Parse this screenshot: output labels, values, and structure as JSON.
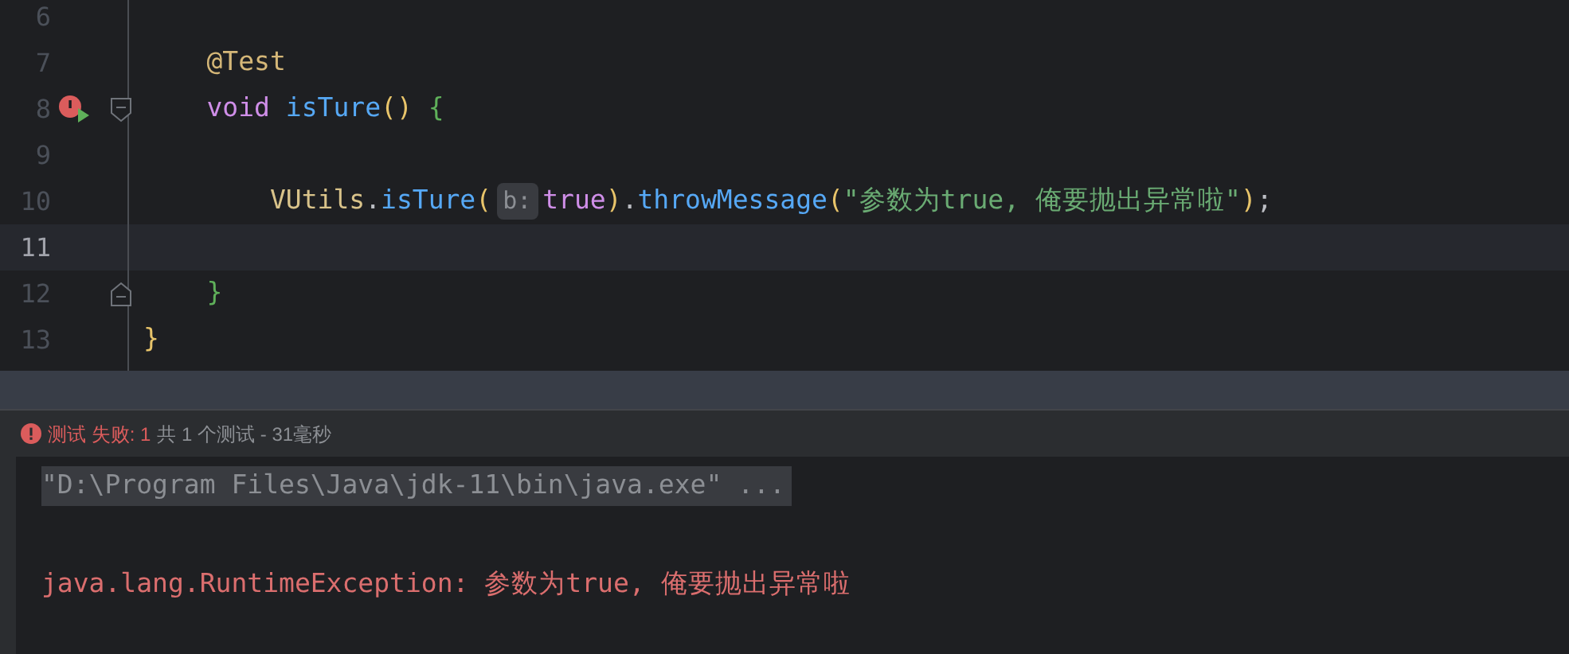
{
  "editor": {
    "lines": [
      {
        "number": "6",
        "current": false
      },
      {
        "number": "7",
        "current": false,
        "tokens": [
          {
            "kind": "annotation",
            "text": "    @Test"
          }
        ]
      },
      {
        "number": "8",
        "current": false,
        "gutter_icons": [
          {
            "kind": "failed_test_run"
          },
          {
            "kind": "fold_start"
          }
        ],
        "tokens": [
          {
            "kind": "keyword",
            "text": "    void"
          },
          {
            "kind": "method",
            "text": " isTure"
          },
          {
            "kind": "paren",
            "text": "()"
          },
          {
            "kind": "brace",
            "text": " {"
          }
        ]
      },
      {
        "number": "9",
        "current": false
      },
      {
        "number": "10",
        "current": false,
        "tokens": [
          {
            "kind": "class",
            "text": "        VUtils"
          },
          {
            "kind": "plain",
            "text": "."
          },
          {
            "kind": "method",
            "text": "isTure"
          },
          {
            "kind": "paren",
            "text": "("
          },
          {
            "kind": "hint",
            "text": "b:"
          },
          {
            "kind": "keyword",
            "text": "true"
          },
          {
            "kind": "paren",
            "text": ")"
          },
          {
            "kind": "plain",
            "text": "."
          },
          {
            "kind": "method",
            "text": "throwMessage"
          },
          {
            "kind": "paren",
            "text": "("
          },
          {
            "kind": "string",
            "text": "\"参数为true, 俺要抛出异常啦\""
          },
          {
            "kind": "paren",
            "text": ")"
          },
          {
            "kind": "plain",
            "text": ";"
          }
        ]
      },
      {
        "number": "11",
        "current": true
      },
      {
        "number": "12",
        "current": false,
        "gutter_icons": [
          {
            "kind": "fold_end"
          }
        ],
        "tokens": [
          {
            "kind": "brace",
            "text": "    }"
          }
        ]
      },
      {
        "number": "13",
        "current": false,
        "tokens": [
          {
            "kind": "paren",
            "text": "}"
          }
        ]
      }
    ]
  },
  "test_status": {
    "failed": "测试 失败: 1",
    "summary": "共 1 个测试 - 31毫秒"
  },
  "console": {
    "lines": [
      {
        "kind": "command",
        "text": "\"D:\\Program Files\\Java\\jdk-11\\bin\\java.exe\" ..."
      },
      {
        "kind": "blank"
      },
      {
        "kind": "error",
        "text": "java.lang.RuntimeException: 参数为true, 俺要抛出异常啦"
      }
    ]
  }
}
